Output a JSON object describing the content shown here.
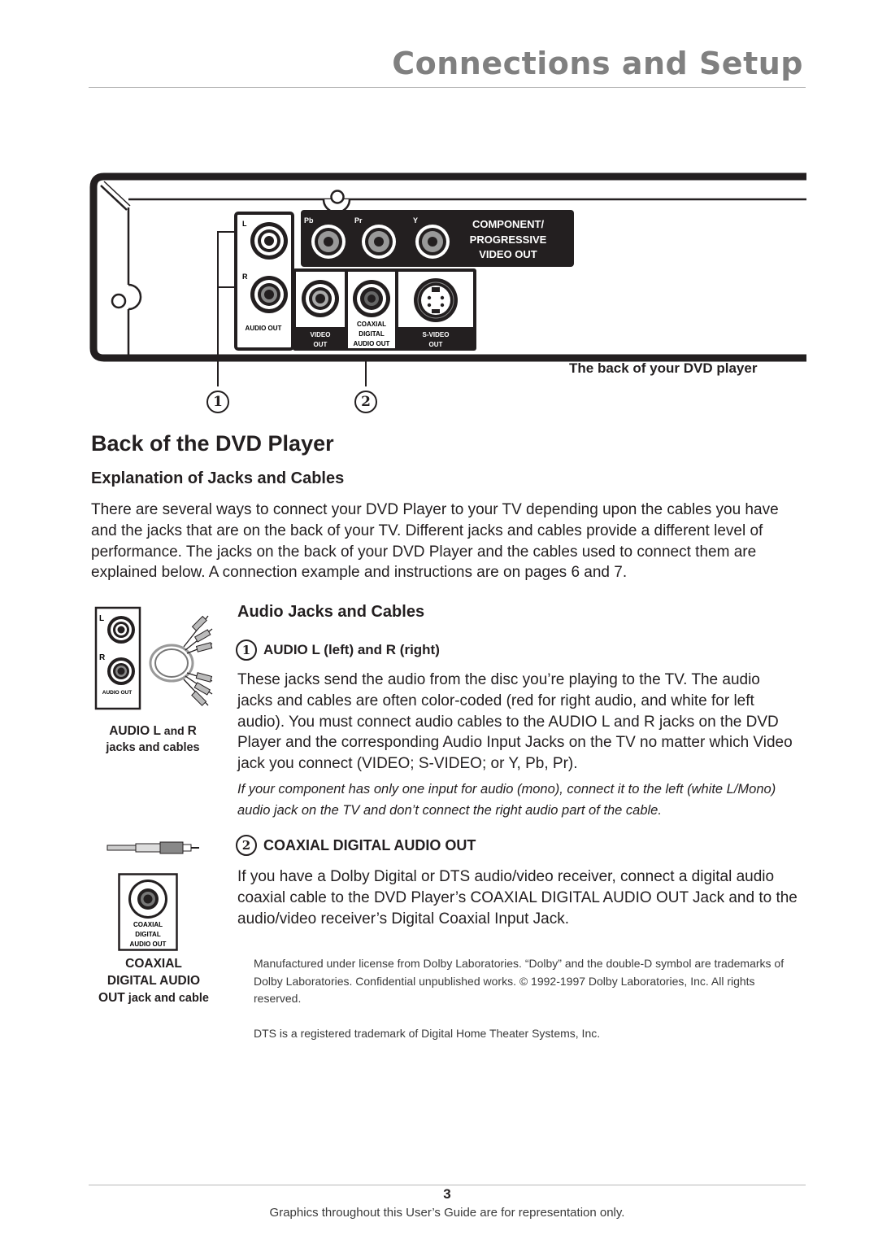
{
  "header": {
    "title": "Connections and Setup"
  },
  "diagram": {
    "labels": {
      "audio_l": "L",
      "audio_r": "R",
      "audio_out": "AUDIO OUT",
      "pb": "Pb",
      "pr": "Pr",
      "y": "Y",
      "component_line1": "COMPONENT/",
      "component_line2": "PROGRESSIVE",
      "component_line3": "VIDEO OUT",
      "video_out_line1": "VIDEO",
      "video_out_line2": "OUT",
      "coaxial_line1": "COAXIAL",
      "coaxial_line2": "DIGITAL",
      "coaxial_line3": "AUDIO OUT",
      "svideo_line1": "S-VIDEO",
      "svideo_line2": "OUT"
    },
    "caption": "The back of your DVD player",
    "callouts": [
      "1",
      "2"
    ]
  },
  "section": {
    "title": "Back of the DVD Player",
    "subtitle": "Explanation of Jacks and Cables",
    "intro": "There are several ways to connect your DVD Player to your TV depending upon the cables you have and the jacks that are on the back of your TV. Different jacks and cables provide a different level of performance. The jacks on the back of your DVD Player and the cables used to connect them are explained below. A connection example and instructions are on pages 6 and 7."
  },
  "figures": {
    "audio": {
      "jack_l": "L",
      "jack_r": "R",
      "jack_label": "AUDIO OUT",
      "caption_bold": "AUDIO L",
      "caption_and": " and ",
      "caption_r": "R",
      "caption_line2": "jacks and cables"
    },
    "coaxial": {
      "jack_line1": "COAXIAL",
      "jack_line2": "DIGITAL",
      "jack_line3": "AUDIO OUT",
      "caption_line1": "COAXIAL",
      "caption_line2": "DIGITAL AUDIO",
      "caption_line3_bold": "OUT",
      "caption_line3_rest": " jack and cable"
    }
  },
  "audio_section": {
    "heading": "Audio Jacks and Cables",
    "item1": {
      "number": "1",
      "title": "AUDIO L (left) and R (right)",
      "body": "These jacks send the audio from the disc you’re playing to the TV. The audio jacks and cables are often color-coded (red for right audio, and white for left audio). You must connect audio cables to the AUDIO L and R jacks on the DVD Player and the corresponding Audio Input Jacks on the TV no matter which Video jack you connect (VIDEO; S-VIDEO; or Y, Pb, Pr).",
      "note": "If your component has only one input for audio (mono), connect it to the left (white L/Mono) audio jack on the TV and don’t connect the right audio part of the cable."
    },
    "item2": {
      "number": "2",
      "title": "COAXIAL DIGITAL AUDIO OUT",
      "body": "If you have a Dolby Digital or DTS audio/video receiver, connect a digital audio coaxial cable to the DVD Player’s COAXIAL DIGITAL AUDIO OUT Jack and to the audio/video receiver’s Digital Coaxial Input Jack."
    },
    "dolby_notice": "Manufactured under license from Dolby Laboratories. “Dolby” and the double-D symbol are trademarks of Dolby Laboratories. Confidential unpublished works. © 1992-1997 Dolby Laboratories, Inc. All rights reserved.",
    "dts_notice": "DTS is a registered trademark of Digital Home Theater Systems, Inc."
  },
  "footer": {
    "page_number": "3",
    "note": "Graphics throughout this User’s Guide are for representation only."
  }
}
